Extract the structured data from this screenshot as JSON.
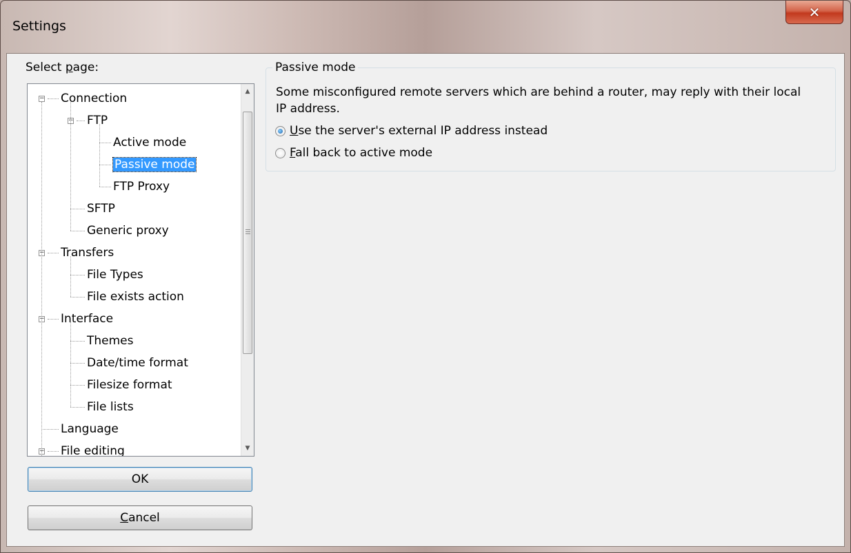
{
  "window": {
    "title": "Settings"
  },
  "sidebar": {
    "select_label_prefix": "Select ",
    "select_label_accel": "p",
    "select_label_rest": "age:",
    "tree": [
      {
        "label": "Connection",
        "level": 0,
        "expander": "−"
      },
      {
        "label": "FTP",
        "level": 1,
        "expander": "−"
      },
      {
        "label": "Active mode",
        "level": 2
      },
      {
        "label": "Passive mode",
        "level": 2,
        "selected": true
      },
      {
        "label": "FTP Proxy",
        "level": 2
      },
      {
        "label": "SFTP",
        "level": 1
      },
      {
        "label": "Generic proxy",
        "level": 1
      },
      {
        "label": "Transfers",
        "level": 0,
        "expander": "−"
      },
      {
        "label": "File Types",
        "level": 1
      },
      {
        "label": "File exists action",
        "level": 1
      },
      {
        "label": "Interface",
        "level": 0,
        "expander": "−"
      },
      {
        "label": "Themes",
        "level": 1
      },
      {
        "label": "Date/time format",
        "level": 1
      },
      {
        "label": "Filesize format",
        "level": 1
      },
      {
        "label": "File lists",
        "level": 1
      },
      {
        "label": "Language",
        "level": 0
      },
      {
        "label": "File editing",
        "level": 0,
        "expander": "−"
      }
    ]
  },
  "buttons": {
    "ok_label": "OK",
    "cancel_accel": "C",
    "cancel_rest": "ancel"
  },
  "main": {
    "group_title": "Passive mode",
    "description": "Some misconfigured remote servers which are behind a router, may reply with their local IP address.",
    "options": [
      {
        "accel": "U",
        "rest": "se the server's external IP address instead",
        "checked": true
      },
      {
        "accel": "F",
        "rest": "all back to active mode",
        "checked": false
      }
    ]
  },
  "colors": {
    "selection": "#3399ff",
    "close_button": "#c2391e",
    "dialog_bg": "#f0f0f0"
  }
}
